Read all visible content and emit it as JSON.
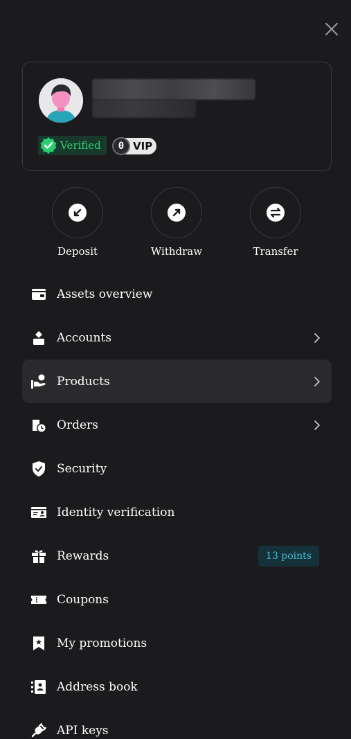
{
  "profile": {
    "verified_label": "Verified",
    "vip_level": "0",
    "vip_label": "VIP"
  },
  "actions": [
    {
      "label": "Deposit",
      "icon": "deposit-arrow-icon"
    },
    {
      "label": "Withdraw",
      "icon": "withdraw-arrow-icon"
    },
    {
      "label": "Transfer",
      "icon": "transfer-arrows-icon"
    }
  ],
  "menu": {
    "items": [
      {
        "label": "Assets overview",
        "icon": "wallet-icon"
      },
      {
        "label": "Accounts",
        "icon": "accounts-icon",
        "has_chevron": true
      },
      {
        "label": "Products",
        "icon": "products-icon",
        "has_chevron": true,
        "active": true
      },
      {
        "label": "Orders",
        "icon": "orders-icon",
        "has_chevron": true
      },
      {
        "label": "Security",
        "icon": "shield-check-icon"
      },
      {
        "label": "Identity verification",
        "icon": "id-card-icon"
      },
      {
        "label": "Rewards",
        "icon": "gift-icon",
        "badge": "13 points"
      },
      {
        "label": "Coupons",
        "icon": "ticket-icon"
      },
      {
        "label": "My promotions",
        "icon": "bookmark-star-icon"
      },
      {
        "label": "Address book",
        "icon": "address-book-icon"
      },
      {
        "label": "API keys",
        "icon": "plug-icon"
      }
    ]
  },
  "colors": {
    "background": "#1b1b1d",
    "verified_green": "#2ecc71",
    "points_teal": "#3fbfd3"
  }
}
